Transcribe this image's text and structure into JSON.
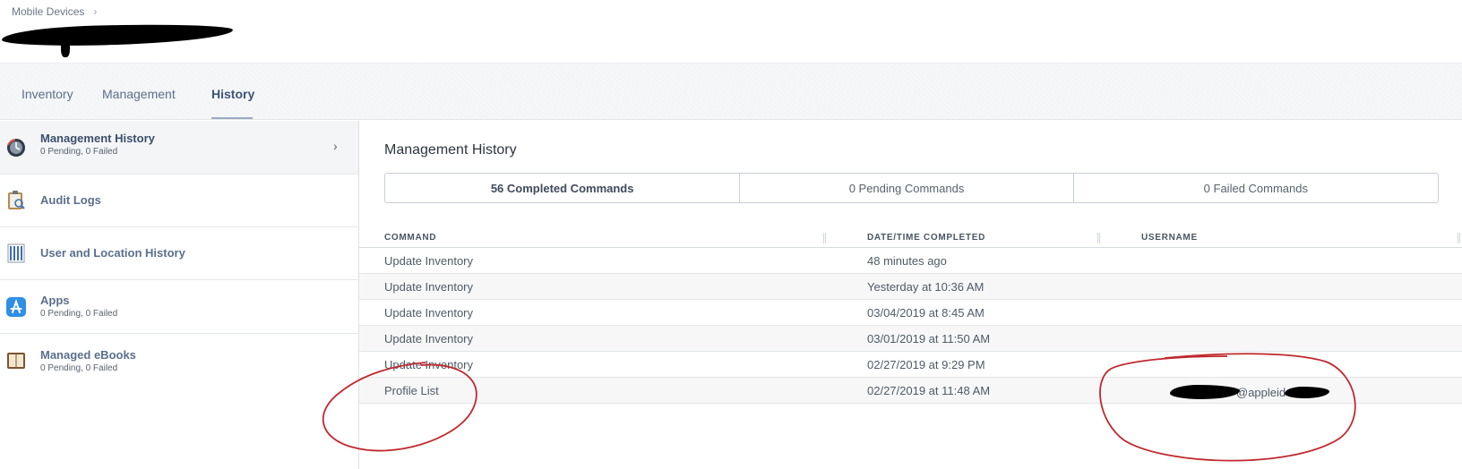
{
  "breadcrumb": {
    "parent": "Mobile Devices",
    "separator": "›"
  },
  "tabs": [
    {
      "label": "Inventory"
    },
    {
      "label": "Management"
    },
    {
      "label": "History",
      "active": true
    }
  ],
  "sidebar": {
    "items": [
      {
        "label": "Management History",
        "sub": "0 Pending, 0 Failed",
        "icon": "clock-globe-icon",
        "active": true
      },
      {
        "label": "Audit Logs",
        "sub": "",
        "icon": "clipboard-search-icon"
      },
      {
        "label": "User and Location History",
        "sub": "",
        "icon": "building-icon"
      },
      {
        "label": "Apps",
        "sub": "0 Pending, 0 Failed",
        "icon": "app-store-icon"
      },
      {
        "label": "Managed eBooks",
        "sub": "0 Pending, 0 Failed",
        "icon": "book-icon"
      }
    ]
  },
  "main": {
    "title": "Management History",
    "segments": [
      {
        "label": "56 Completed Commands",
        "active": true
      },
      {
        "label": "0 Pending Commands"
      },
      {
        "label": "0 Failed Commands"
      }
    ],
    "table": {
      "headers": [
        "COMMAND",
        "DATE/TIME COMPLETED",
        "USERNAME"
      ],
      "rows": [
        {
          "command": "Update Inventory",
          "datetime": "48 minutes ago",
          "username": ""
        },
        {
          "command": "Update Inventory",
          "datetime": "Yesterday at 10:36 AM",
          "username": ""
        },
        {
          "command": "Update Inventory",
          "datetime": "03/04/2019 at 8:45 AM",
          "username": ""
        },
        {
          "command": "Update Inventory",
          "datetime": "03/01/2019 at 11:50 AM",
          "username": ""
        },
        {
          "command": "Update Inventory",
          "datetime": "02/27/2019 at 9:29 PM",
          "username": ""
        },
        {
          "command": "Profile List",
          "datetime": "02/27/2019 at 11:48 AM",
          "username": "@appleid"
        }
      ]
    }
  },
  "colors": {
    "annotation": "#c0282d",
    "redaction": "#000000",
    "tab_active": "#3c5576"
  }
}
